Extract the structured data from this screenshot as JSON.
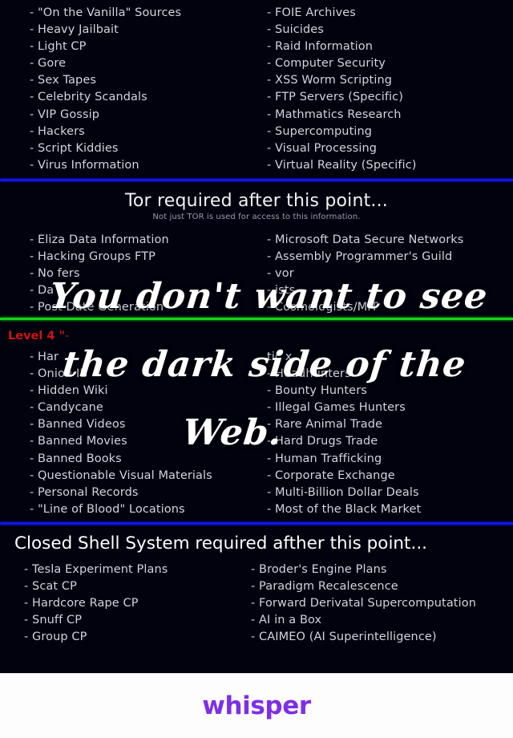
{
  "image": {
    "background_color": "#02020f",
    "body_text_color": "#d2d4de",
    "divider_blue": "#1414e6",
    "divider_green": "#17d417",
    "level_label_color": "#cf1414",
    "overlay_text_color": "#ffffff"
  },
  "sections": {
    "top_list": {
      "left_items": [
        "- \"On the Vanilla\" Sources",
        "- Heavy Jailbait",
        "- Light CP",
        "- Gore",
        "- Sex Tapes",
        "- Celebrity Scandals",
        "- VIP Gossip",
        "- Hackers",
        "- Script Kiddies",
        "- Virus Information"
      ],
      "right_items": [
        "- FOIE Archives",
        "- Suicides",
        "- Raid Information",
        "- Computer Security",
        "- XSS Worm Scripting",
        "- FTP Servers (Specific)",
        "- Mathmatics Research",
        "- Supercomputing",
        "- Visual Processing",
        "- Virtual Reality (Specific)"
      ]
    },
    "tor_banner": {
      "title": "Tor required after this point...",
      "subtitle": "Not just TOR is used for access to this information."
    },
    "tor_list": {
      "left_items": [
        "- Eliza Data Information",
        "- Hacking Groups FTP",
        "- No        fers",
        "- Da        s",
        "- Post Date Generation"
      ],
      "right_items": [
        "- Microsoft Data Secure Networks",
        "- Assembly Programmer's Guild",
        "-        vor",
        "-        ists",
        "- Cosmologists/MIT"
      ]
    },
    "level4": {
      "label_prefix": "Level 4 \"",
      "label_rest": "-",
      "left_items": [
        "- Har",
        "- Onion IB",
        "- Hidden Wiki",
        "- Candycane",
        "- Banned Videos",
        "- Banned Movies",
        "- Banned Books",
        "- Questionable Visual Materials",
        "- Personal Records",
        "- \"Line of Blood\" Locations"
      ],
      "right_items": [
        "tic       x",
        "- Headhunters",
        "- Bounty Hunters",
        "- Illegal Games Hunters",
        "- Rare Animal Trade",
        "- Hard Drugs Trade",
        "- Human Trafficking",
        "- Corporate Exchange",
        "- Multi-Billion Dollar Deals",
        "- Most of the Black Market"
      ]
    },
    "closed_shell_banner": {
      "title": "Closed Shell System required afther this point..."
    },
    "closed_shell_list": {
      "left_items": [
        "- Tesla Experiment Plans",
        "- Scat CP",
        "- Hardcore Rape CP",
        "- Snuff CP",
        "- Group CP"
      ],
      "right_items": [
        "- Broder's Engine Plans",
        "- Paradigm Recalescence",
        "- Forward Derivatal Supercomputation",
        "- AI in a Box",
        "- CAIMEO (AI Superintelligence)"
      ]
    }
  },
  "overlay": {
    "line1": "You don't want to see",
    "line2": "the dark side of the",
    "line3": "Web."
  },
  "footer": {
    "logo": "whisper"
  }
}
